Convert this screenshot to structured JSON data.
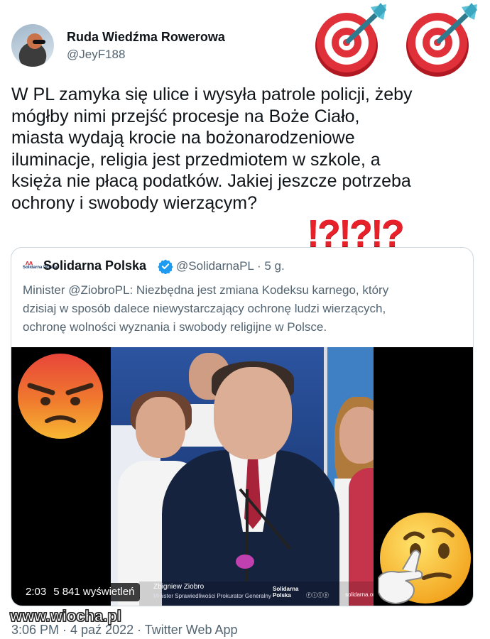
{
  "author": {
    "display_name": "Ruda Wiedźma Rowerowa",
    "handle": "@JeyF188"
  },
  "tweet": {
    "text": "W PL zamyka się ulice i wysyła patrole policji, żeby\nmógłby nimi przejść procesje na Boże Ciało,\nmiasta wydają krocie na bożonarodzeniowe\niluminacje, religia jest przedmiotem w szkole, a\nksięża nie płacą podatków. Jakiej jeszcze potrzeba\nochrony i swobody wierzącym?"
  },
  "overlays": {
    "exclamations": "!?!?!?",
    "target_icon": "target-with-dart-icon",
    "angry_emoji": "angry-face-emoji",
    "thinking_emoji": "thinking-face-emoji"
  },
  "quoted_tweet": {
    "logo_label": "Solidarna Polska",
    "display_name": "Solidarna Polska",
    "verified_icon": "verified-badge-icon",
    "handle_time": "@SolidarnaPL · 5 g.",
    "text": "Minister @ZiobroPL: Niezbędna jest zmiana Kodeksu karnego, który\ndzisiaj w sposób dalece niewystarczający ochronę ludzi wierzących,\nochronę wolności wyznania i swobody religijne w Polsce.",
    "video": {
      "duration": "2:03",
      "views": "5 841 wyświetleń",
      "lower_third_name": "Zbigniew Ziobro",
      "lower_third_title": "Minister Sprawiedliwości Prokurator Generalny",
      "lower_third_logo": "Solidarna\nPolska",
      "lower_third_url": "solidarna.org"
    }
  },
  "footer": {
    "meta": "3:06 PM · 4 paź 2022 · Twitter Web App"
  },
  "watermark": "www.wiocha.pl",
  "colors": {
    "text": "#0f1419",
    "secondary": "#536471",
    "border": "#cfd9de",
    "verified": "#1d9bf0",
    "exclamation": "#e8202a"
  }
}
